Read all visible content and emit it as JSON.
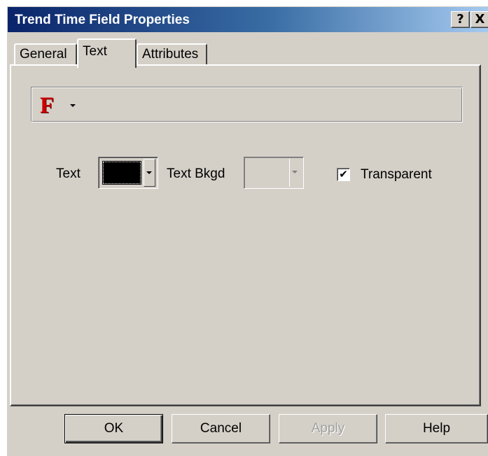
{
  "window": {
    "title": "Trend Time Field Properties",
    "help_button": "?",
    "close_button": "X"
  },
  "tabs": [
    {
      "label": "General",
      "active": false
    },
    {
      "label": "Text",
      "active": true
    },
    {
      "label": "Attributes",
      "active": false
    }
  ],
  "font_bar": {
    "icon_glyph": "F",
    "icon": "font-icon",
    "dropdown_icon": "chevron-down-icon"
  },
  "text_section": {
    "text_label": "Text",
    "text_color": "#000000",
    "bkgd_label": "Text Bkgd",
    "bkgd_enabled": false,
    "transparent_label": "Transparent",
    "transparent_checked": true,
    "check_glyph": "✔"
  },
  "buttons": {
    "ok": "OK",
    "cancel": "Cancel",
    "apply": "Apply",
    "help": "Help"
  },
  "colors": {
    "dialog_face": "#d4d0c8",
    "titlebar_start": "#0a246a",
    "titlebar_end": "#a6caf0",
    "font_icon": "#cc0000"
  }
}
